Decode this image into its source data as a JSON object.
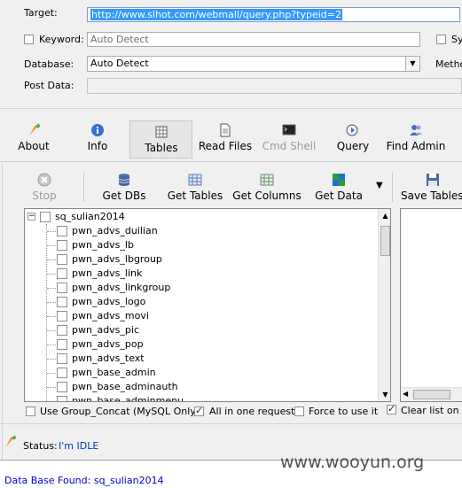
{
  "form": {
    "target_label": "Target:",
    "target_value": "http://www.slhot.com/webmall/query.php?typeid=2",
    "keyword_label": "Keyword:",
    "keyword_value": "Auto Detect",
    "sy_label": "Sy",
    "database_label": "Database:",
    "database_value": "Auto Detect",
    "method_label": "Metho",
    "postdata_label": "Post Data:"
  },
  "main_tabs": [
    {
      "label": "About",
      "icon": "carrot-icon"
    },
    {
      "label": "Info",
      "icon": "info-icon"
    },
    {
      "label": "Tables",
      "icon": "table-icon"
    },
    {
      "label": "Read Files",
      "icon": "file-icon"
    },
    {
      "label": "Cmd Shell",
      "icon": "terminal-icon"
    },
    {
      "label": "Query",
      "icon": "query-icon"
    },
    {
      "label": "Find Admin",
      "icon": "users-icon"
    }
  ],
  "toolbar": {
    "stop": "Stop",
    "get_dbs": "Get DBs",
    "get_tables": "Get Tables",
    "get_columns": "Get Columns",
    "get_data": "Get Data",
    "save_tables": "Save Tables"
  },
  "tree": {
    "root": "sq_sulian2014",
    "items": [
      "pwn_advs_duilian",
      "pwn_advs_lb",
      "pwn_advs_lbgroup",
      "pwn_advs_link",
      "pwn_advs_linkgroup",
      "pwn_advs_logo",
      "pwn_advs_movi",
      "pwn_advs_pic",
      "pwn_advs_pop",
      "pwn_advs_text",
      "pwn_base_admin",
      "pwn_base_adminauth",
      "pwn_base_adminmenu"
    ]
  },
  "options": {
    "group_concat": "Use Group_Concat (MySQL Only)",
    "all_in_one": "All in one request.",
    "force": "Force to use it",
    "clear_list": "Clear list on ge"
  },
  "status": {
    "label": "Status:",
    "value": "I'm IDLE"
  },
  "log": {
    "line1": "Data Base Found: sq_sulian2014"
  },
  "watermark": "www.wooyun.org",
  "colors": {
    "selection": "#3399ff",
    "status_blue": "#0033cc",
    "log_blue": "#0000cc"
  }
}
